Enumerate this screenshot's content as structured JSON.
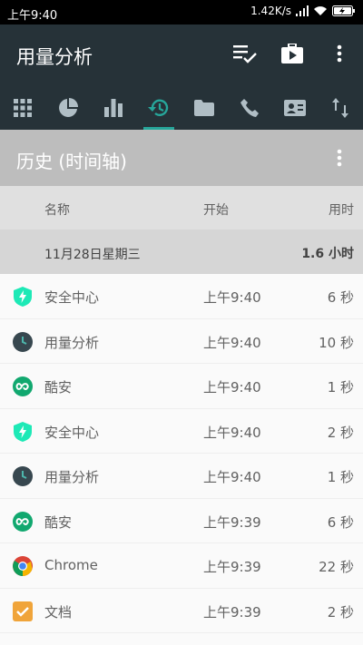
{
  "status_bar": {
    "time": "上午9:40",
    "net_speed": "1.42K/s"
  },
  "app_bar": {
    "title": "用量分析",
    "actions": [
      "checklist-icon",
      "briefcase-play-icon",
      "more-vert-icon"
    ]
  },
  "tabs": [
    {
      "icon": "grid-icon",
      "active": false
    },
    {
      "icon": "pie-chart-icon",
      "active": false
    },
    {
      "icon": "bar-chart-icon",
      "active": false
    },
    {
      "icon": "history-icon",
      "active": true
    },
    {
      "icon": "folder-icon",
      "active": false
    },
    {
      "icon": "phone-icon",
      "active": false
    },
    {
      "icon": "contact-card-icon",
      "active": false
    },
    {
      "icon": "swap-vert-icon",
      "active": false
    }
  ],
  "section": {
    "title": "历史 (时间轴)"
  },
  "columns": {
    "name": "名称",
    "start": "开始",
    "duration": "用时"
  },
  "day": {
    "date": "11月28日星期三",
    "total": "1.6 小时"
  },
  "rows": [
    {
      "name": "安全中心",
      "start": "上午9:40",
      "duration": "6 秒",
      "icon": "security-shield-icon"
    },
    {
      "name": "用量分析",
      "start": "上午9:40",
      "duration": "10 秒",
      "icon": "usage-clock-icon"
    },
    {
      "name": "酷安",
      "start": "上午9:40",
      "duration": "1 秒",
      "icon": "coolapk-icon"
    },
    {
      "name": "安全中心",
      "start": "上午9:40",
      "duration": "2 秒",
      "icon": "security-shield-icon"
    },
    {
      "name": "用量分析",
      "start": "上午9:40",
      "duration": "1 秒",
      "icon": "usage-clock-icon"
    },
    {
      "name": "酷安",
      "start": "上午9:39",
      "duration": "6 秒",
      "icon": "coolapk-icon"
    },
    {
      "name": "Chrome",
      "start": "上午9:39",
      "duration": "22 秒",
      "icon": "chrome-icon"
    },
    {
      "name": "文档",
      "start": "上午9:39",
      "duration": "2 秒",
      "icon": "docs-check-icon"
    }
  ],
  "colors": {
    "app_bar": "#263238",
    "accent": "#26a69a",
    "section": "#bdbdbd"
  }
}
